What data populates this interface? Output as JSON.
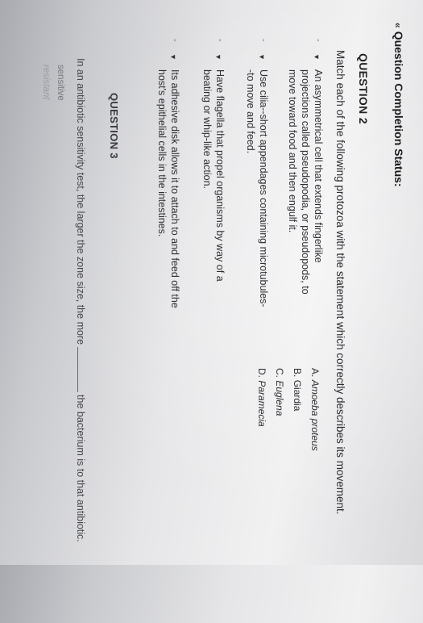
{
  "status": {
    "chevron": "«",
    "label": "Question Completion Status:"
  },
  "question2": {
    "title": "QUESTION 2",
    "prompt": "Match each of the following protozoa with the statement which correctly describes its movement.",
    "rows": [
      {
        "bullet": "-",
        "line1": "An asymmetrical cell that extends fingerlike",
        "line2": "projections called pseudopodia, or pseudopods, to",
        "line3": "move toward food and then engulf it."
      },
      {
        "bullet": "-",
        "line1": "Use cilia--short appendages containing microtubules-",
        "line2": "-to move and feed.",
        "line3": ""
      },
      {
        "bullet": "-",
        "line1": "Have flagella that propel organisms by way of a",
        "line2": "beating or whip-like action.",
        "line3": ""
      },
      {
        "bullet": "-",
        "line1": "Its adhesive disk allows it to attach to and feed off the",
        "line2": "host's epithelial cells in the intestines.",
        "line3": ""
      }
    ],
    "answers": [
      {
        "letter": "A.",
        "text": "Amoeba proteus"
      },
      {
        "letter": "B.",
        "text": "Giardia"
      },
      {
        "letter": "C.",
        "text": "Euglena"
      },
      {
        "letter": "D.",
        "text": "Paramecia"
      }
    ]
  },
  "question3": {
    "title": "QUESTION 3",
    "text_before": "In an antibiotic sensitivity test, the larger the zone size, the more",
    "text_after": "the bacterium is to that antibiotic.",
    "choices": [
      "sensitive",
      "resistant"
    ]
  }
}
